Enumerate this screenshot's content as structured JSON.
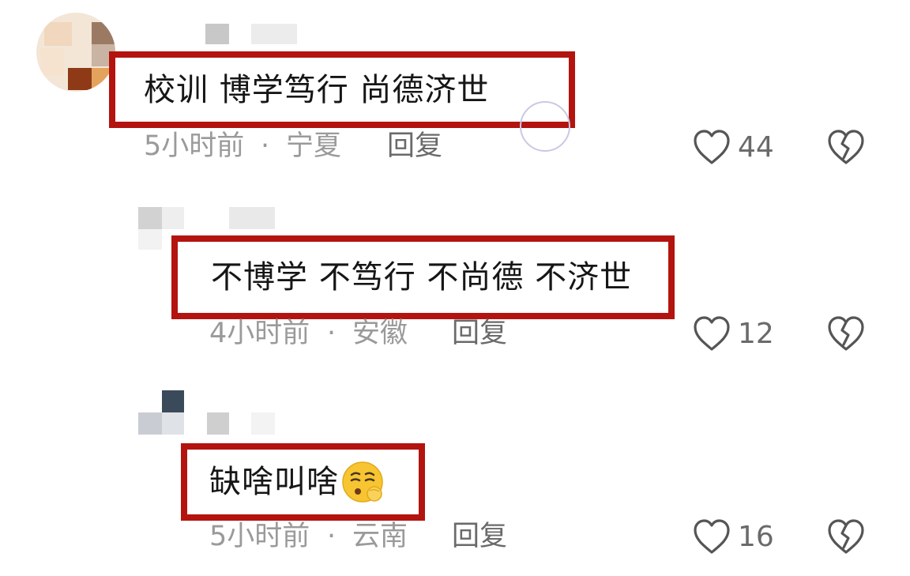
{
  "comments": [
    {
      "text": "校训 博学笃行 尚德济世",
      "time": "5小时前",
      "separator": "·",
      "location": "宁夏",
      "reply_label": "回复",
      "likes": "44"
    },
    {
      "text": "不博学 不笃行 不尚德 不济世",
      "time": "4小时前",
      "separator": "·",
      "location": "安徽",
      "reply_label": "回复",
      "likes": "12"
    },
    {
      "text": "缺啥叫啥",
      "time": "5小时前",
      "separator": "·",
      "location": "云南",
      "reply_label": "回复",
      "likes": "16"
    }
  ],
  "icons": {
    "like": "heart-outline-icon",
    "dislike": "broken-heart-icon",
    "emoji": "shushing-face-emoji"
  },
  "colors": {
    "highlight_border": "#b3140f",
    "meta_text": "#9a9a9a",
    "icon_stroke": "#555555"
  }
}
